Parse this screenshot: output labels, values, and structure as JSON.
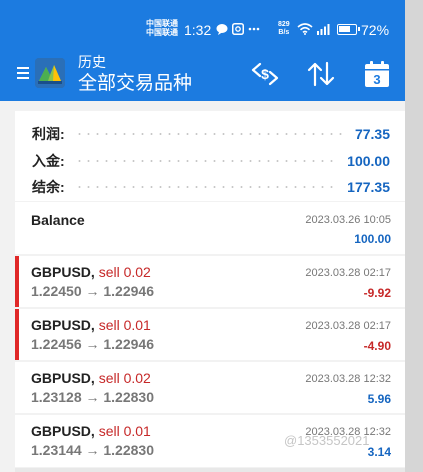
{
  "status_bar": {
    "carrier_line1": "中国联通",
    "carrier_line2": "中国联通",
    "time": "1:32",
    "speed_value": "829",
    "speed_unit": "B/s",
    "battery_percent": "72%",
    "battery_level": 0.72
  },
  "header": {
    "title": "历史",
    "subtitle": "全部交易品种",
    "calendar_day": "3"
  },
  "summary": [
    {
      "label": "利润:",
      "value": "77.35"
    },
    {
      "label": "入金:",
      "value": "100.00"
    },
    {
      "label": "结余:",
      "value": "177.35"
    }
  ],
  "deal_list": [
    {
      "title": "Balance",
      "date": "2023.03.26 10:05",
      "amount": "100.00",
      "amount_sign": "positive"
    },
    {
      "symbol": "GBPUSD,",
      "action": "sell 0.02",
      "prices": "1.22450 → 1.22946",
      "date": "2023.03.28 02:17",
      "amount": "-9.92",
      "amount_sign": "negative"
    },
    {
      "symbol": "GBPUSD,",
      "action": "sell 0.01",
      "prices": "1.22456 → 1.22946",
      "date": "2023.03.28 02:17",
      "amount": "-4.90",
      "amount_sign": "negative"
    },
    {
      "symbol": "GBPUSD,",
      "action": "sell 0.02",
      "prices": "1.23128 → 1.22830",
      "date": "2023.03.28 12:32",
      "amount": "5.96",
      "amount_sign": "positive"
    },
    {
      "symbol": "GBPUSD,",
      "action": "sell 0.01",
      "prices": "1.23144 → 1.22830",
      "date": "2023.03.28 12:32",
      "amount": "3.14",
      "amount_sign": "positive"
    }
  ],
  "watermark": "@1353552021",
  "colors": {
    "header_blue": "#1c7be0",
    "loss_red": "#c62828",
    "profit_blue": "#1565c0",
    "loss_marker": "#e02828"
  },
  "icons": {
    "menu": "hamburger-menu-icon",
    "logo": "metatrader-logo-icon",
    "symbol_filter": "currency-swap-icon",
    "sort": "sort-arrows-icon",
    "calendar": "calendar-icon"
  }
}
